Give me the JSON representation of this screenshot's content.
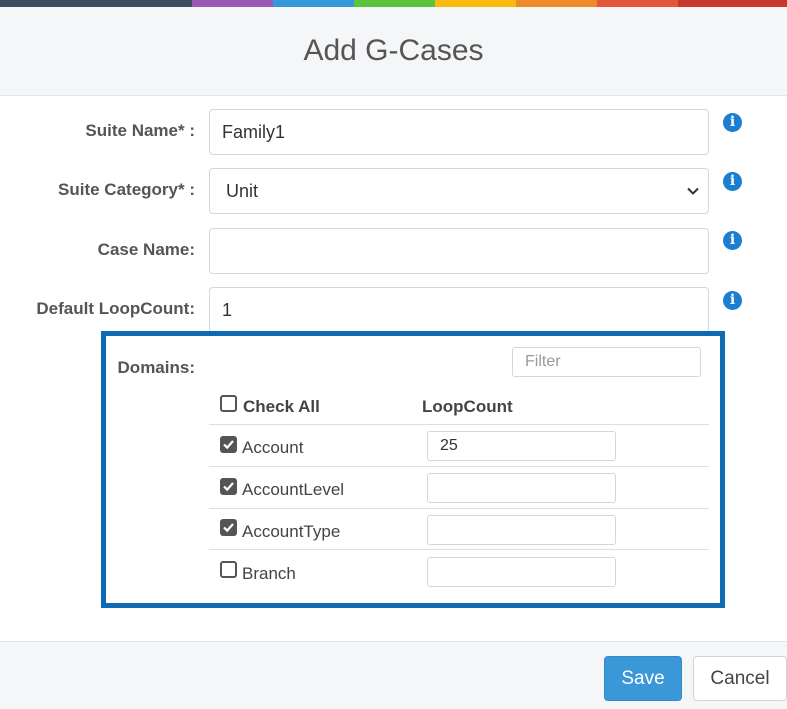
{
  "colors": {
    "stripe": [
      "#3d4c5e",
      "#9b59b6",
      "#3498db",
      "#5cc33f",
      "#f9b90f",
      "#ef8a2a",
      "#e5573a",
      "#c8392b"
    ],
    "accent": "#3a98d8",
    "highlight_border": "#0d6ab5",
    "info_icon": "#1a7fd0"
  },
  "dialog": {
    "title": "Add G-Cases"
  },
  "form": {
    "suite_name": {
      "label": "Suite Name* :",
      "value": "Family1",
      "info_icon": "info-icon"
    },
    "suite_category": {
      "label": "Suite Category* :",
      "value": "Unit",
      "info_icon": "info-icon"
    },
    "case_name": {
      "label": "Case Name:",
      "value": "",
      "info_icon": "info-icon"
    },
    "default_loopcount": {
      "label": "Default LoopCount:",
      "value": "1",
      "info_icon": "info-icon"
    }
  },
  "domains": {
    "label": "Domains:",
    "filter_placeholder": "Filter",
    "check_all_label": "Check All",
    "loopcount_header": "LoopCount",
    "rows": [
      {
        "name": "Account",
        "checked": true,
        "loopcount": "25"
      },
      {
        "name": "AccountLevel",
        "checked": true,
        "loopcount": ""
      },
      {
        "name": "AccountType",
        "checked": true,
        "loopcount": ""
      },
      {
        "name": "Branch",
        "checked": false,
        "loopcount": ""
      }
    ]
  },
  "footer": {
    "save_label": "Save",
    "cancel_label": "Cancel"
  }
}
